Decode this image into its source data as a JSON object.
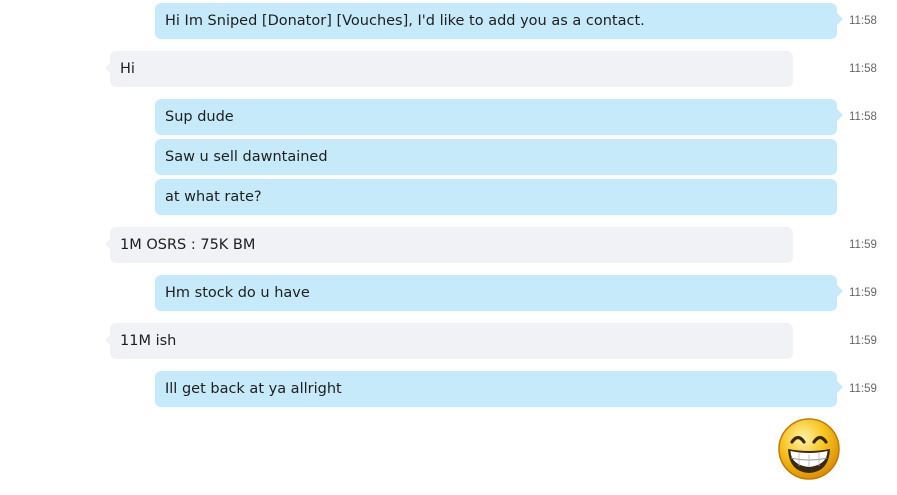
{
  "conversation": {
    "messages": [
      {
        "direction": "outgoing",
        "text": "Hi Im Sniped [Donator] [Vouches], I'd like to add you as a contact.",
        "time": "11:58"
      },
      {
        "direction": "incoming",
        "text": "Hi",
        "time": "11:58"
      },
      {
        "direction": "outgoing",
        "text": "Sup dude",
        "time": "11:58"
      },
      {
        "direction": "outgoing",
        "text": "Saw u sell dawntained",
        "time": ""
      },
      {
        "direction": "outgoing",
        "text": "at what rate?",
        "time": ""
      },
      {
        "direction": "incoming",
        "text": "1M OSRS : 75K BM",
        "time": "11:59"
      },
      {
        "direction": "outgoing",
        "text": "Hm stock do u have",
        "time": "11:59"
      },
      {
        "direction": "incoming",
        "text": "11M ish",
        "time": "11:59"
      },
      {
        "direction": "outgoing",
        "text": "Ill get back at ya allright",
        "time": "11:59"
      }
    ],
    "sticker": {
      "icon": "grinning-face-emoji"
    }
  },
  "colors": {
    "outgoing_bubble": "#c7eafb",
    "incoming_bubble": "#f1f2f6",
    "timestamp": "#666666",
    "emoji_face": "#f6c21c"
  }
}
